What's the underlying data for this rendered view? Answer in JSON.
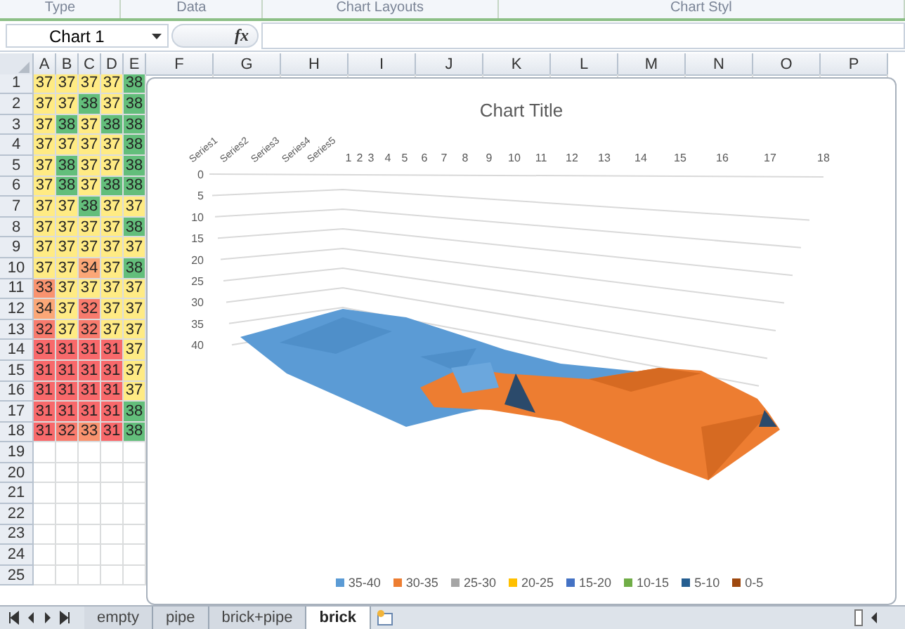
{
  "ribbon": {
    "groups": [
      "Type",
      "Data",
      "Chart Layouts",
      "Chart Styl"
    ]
  },
  "formula_bar": {
    "name_box": "Chart 1",
    "function_button": "fx"
  },
  "sheet": {
    "columns": [
      "A",
      "B",
      "C",
      "D",
      "E",
      "F",
      "G",
      "H",
      "I",
      "J",
      "K",
      "L",
      "M",
      "N",
      "O",
      "P"
    ],
    "rows": [
      {
        "number": "1",
        "cells": [
          {
            "value": "37",
            "color": "#ffeb84"
          },
          {
            "value": "37",
            "color": "#ffeb84"
          },
          {
            "value": "37",
            "color": "#ffeb84"
          },
          {
            "value": "37",
            "color": "#ffeb84"
          },
          {
            "value": "38",
            "color": "#63be7b"
          }
        ]
      },
      {
        "number": "2",
        "cells": [
          {
            "value": "37",
            "color": "#ffeb84"
          },
          {
            "value": "37",
            "color": "#ffeb84"
          },
          {
            "value": "38",
            "color": "#63be7b"
          },
          {
            "value": "37",
            "color": "#ffeb84"
          },
          {
            "value": "38",
            "color": "#63be7b"
          }
        ]
      },
      {
        "number": "3",
        "cells": [
          {
            "value": "37",
            "color": "#ffeb84"
          },
          {
            "value": "38",
            "color": "#63be7b"
          },
          {
            "value": "37",
            "color": "#ffeb84"
          },
          {
            "value": "38",
            "color": "#63be7b"
          },
          {
            "value": "38",
            "color": "#63be7b"
          }
        ]
      },
      {
        "number": "4",
        "cells": [
          {
            "value": "37",
            "color": "#ffeb84"
          },
          {
            "value": "37",
            "color": "#ffeb84"
          },
          {
            "value": "37",
            "color": "#ffeb84"
          },
          {
            "value": "37",
            "color": "#ffeb84"
          },
          {
            "value": "38",
            "color": "#63be7b"
          }
        ]
      },
      {
        "number": "5",
        "cells": [
          {
            "value": "37",
            "color": "#ffeb84"
          },
          {
            "value": "38",
            "color": "#63be7b"
          },
          {
            "value": "37",
            "color": "#ffeb84"
          },
          {
            "value": "37",
            "color": "#ffeb84"
          },
          {
            "value": "38",
            "color": "#63be7b"
          }
        ]
      },
      {
        "number": "6",
        "cells": [
          {
            "value": "37",
            "color": "#ffeb84"
          },
          {
            "value": "38",
            "color": "#63be7b"
          },
          {
            "value": "37",
            "color": "#ffeb84"
          },
          {
            "value": "38",
            "color": "#63be7b"
          },
          {
            "value": "38",
            "color": "#63be7b"
          }
        ]
      },
      {
        "number": "7",
        "cells": [
          {
            "value": "37",
            "color": "#ffeb84"
          },
          {
            "value": "37",
            "color": "#ffeb84"
          },
          {
            "value": "38",
            "color": "#63be7b"
          },
          {
            "value": "37",
            "color": "#ffeb84"
          },
          {
            "value": "37",
            "color": "#ffeb84"
          }
        ]
      },
      {
        "number": "8",
        "cells": [
          {
            "value": "37",
            "color": "#ffeb84"
          },
          {
            "value": "37",
            "color": "#ffeb84"
          },
          {
            "value": "37",
            "color": "#ffeb84"
          },
          {
            "value": "37",
            "color": "#ffeb84"
          },
          {
            "value": "38",
            "color": "#63be7b"
          }
        ]
      },
      {
        "number": "9",
        "cells": [
          {
            "value": "37",
            "color": "#ffeb84"
          },
          {
            "value": "37",
            "color": "#ffeb84"
          },
          {
            "value": "37",
            "color": "#ffeb84"
          },
          {
            "value": "37",
            "color": "#ffeb84"
          },
          {
            "value": "37",
            "color": "#ffeb84"
          }
        ]
      },
      {
        "number": "10",
        "cells": [
          {
            "value": "37",
            "color": "#ffeb84"
          },
          {
            "value": "37",
            "color": "#ffeb84"
          },
          {
            "value": "34",
            "color": "#fba777"
          },
          {
            "value": "37",
            "color": "#ffeb84"
          },
          {
            "value": "38",
            "color": "#63be7b"
          }
        ]
      },
      {
        "number": "11",
        "cells": [
          {
            "value": "33",
            "color": "#f9936f"
          },
          {
            "value": "37",
            "color": "#ffeb84"
          },
          {
            "value": "37",
            "color": "#ffeb84"
          },
          {
            "value": "37",
            "color": "#ffeb84"
          },
          {
            "value": "37",
            "color": "#ffeb84"
          }
        ]
      },
      {
        "number": "12",
        "cells": [
          {
            "value": "34",
            "color": "#fba777"
          },
          {
            "value": "37",
            "color": "#ffeb84"
          },
          {
            "value": "32",
            "color": "#f87b6d"
          },
          {
            "value": "37",
            "color": "#ffeb84"
          },
          {
            "value": "37",
            "color": "#ffeb84"
          }
        ]
      },
      {
        "number": "13",
        "cells": [
          {
            "value": "32",
            "color": "#f87b6d"
          },
          {
            "value": "37",
            "color": "#ffeb84"
          },
          {
            "value": "32",
            "color": "#f87b6d"
          },
          {
            "value": "37",
            "color": "#ffeb84"
          },
          {
            "value": "37",
            "color": "#ffeb84"
          }
        ]
      },
      {
        "number": "14",
        "cells": [
          {
            "value": "31",
            "color": "#f8696b"
          },
          {
            "value": "31",
            "color": "#f8696b"
          },
          {
            "value": "31",
            "color": "#f8696b"
          },
          {
            "value": "31",
            "color": "#f8696b"
          },
          {
            "value": "37",
            "color": "#ffeb84"
          }
        ]
      },
      {
        "number": "15",
        "cells": [
          {
            "value": "31",
            "color": "#f8696b"
          },
          {
            "value": "31",
            "color": "#f8696b"
          },
          {
            "value": "31",
            "color": "#f8696b"
          },
          {
            "value": "31",
            "color": "#f8696b"
          },
          {
            "value": "37",
            "color": "#ffeb84"
          }
        ]
      },
      {
        "number": "16",
        "cells": [
          {
            "value": "31",
            "color": "#f8696b"
          },
          {
            "value": "31",
            "color": "#f8696b"
          },
          {
            "value": "31",
            "color": "#f8696b"
          },
          {
            "value": "31",
            "color": "#f8696b"
          },
          {
            "value": "37",
            "color": "#ffeb84"
          }
        ]
      },
      {
        "number": "17",
        "cells": [
          {
            "value": "31",
            "color": "#f8696b"
          },
          {
            "value": "31",
            "color": "#f8696b"
          },
          {
            "value": "31",
            "color": "#f8696b"
          },
          {
            "value": "31",
            "color": "#f8696b"
          },
          {
            "value": "38",
            "color": "#63be7b"
          }
        ]
      },
      {
        "number": "18",
        "cells": [
          {
            "value": "31",
            "color": "#f8696b"
          },
          {
            "value": "32",
            "color": "#f87b6d"
          },
          {
            "value": "33",
            "color": "#f9936f"
          },
          {
            "value": "31",
            "color": "#f8696b"
          },
          {
            "value": "38",
            "color": "#63be7b"
          }
        ]
      },
      {
        "number": "19",
        "cells": []
      },
      {
        "number": "20",
        "cells": []
      },
      {
        "number": "21",
        "cells": []
      },
      {
        "number": "22",
        "cells": []
      },
      {
        "number": "23",
        "cells": []
      },
      {
        "number": "24",
        "cells": []
      },
      {
        "number": "25",
        "cells": []
      }
    ]
  },
  "chart": {
    "title": "Chart Title",
    "series_labels": [
      "Series1",
      "Series2",
      "Series3",
      "Series4",
      "Series5"
    ],
    "category_labels": [
      "1",
      "2",
      "3",
      "4",
      "5",
      "6",
      "7",
      "8",
      "9",
      "10",
      "11",
      "12",
      "13",
      "14",
      "15",
      "16",
      "17",
      "18"
    ],
    "value_labels": [
      "0",
      "5",
      "10",
      "15",
      "20",
      "25",
      "30",
      "35",
      "40"
    ],
    "legend": [
      {
        "label": "35-40",
        "color": "#5b9bd5"
      },
      {
        "label": "30-35",
        "color": "#ed7d31"
      },
      {
        "label": "25-30",
        "color": "#a5a5a5"
      },
      {
        "label": "20-25",
        "color": "#ffc000"
      },
      {
        "label": "15-20",
        "color": "#4472c4"
      },
      {
        "label": "10-15",
        "color": "#70ad47"
      },
      {
        "label": "5-10",
        "color": "#255e91"
      },
      {
        "label": "0-5",
        "color": "#9e480e"
      }
    ]
  },
  "sheet_tabs": [
    {
      "label": "empty",
      "selected": false
    },
    {
      "label": "pipe",
      "selected": false
    },
    {
      "label": "brick+pipe",
      "selected": false
    },
    {
      "label": "brick",
      "selected": true
    }
  ]
}
